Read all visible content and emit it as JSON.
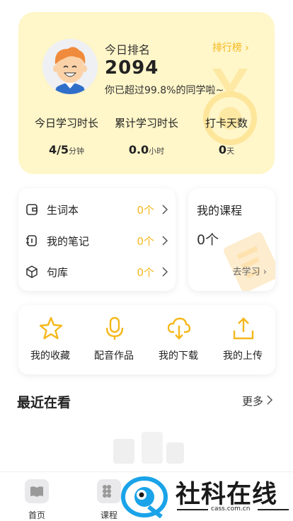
{
  "rank": {
    "label": "今日排名",
    "link": "排行榜",
    "value": "2094",
    "desc": "你已超过99.8%的同学啦~"
  },
  "stats": [
    {
      "label": "今日学习时长",
      "value": "4/5",
      "unit": "分钟"
    },
    {
      "label": "累计学习时长",
      "value": "0.0",
      "unit": "小时"
    },
    {
      "label": "打卡天数",
      "value": "0",
      "unit": "天"
    }
  ],
  "lists": [
    {
      "label": "生词本",
      "count": "0个",
      "icon": "wallet-icon"
    },
    {
      "label": "我的笔记",
      "count": "0个",
      "icon": "notebook-icon"
    },
    {
      "label": "句库",
      "count": "0个",
      "icon": "box-icon"
    }
  ],
  "course": {
    "title": "我的课程",
    "count": "0个",
    "go": "去学习"
  },
  "actions": [
    {
      "label": "我的收藏",
      "icon": "star-icon"
    },
    {
      "label": "配音作品",
      "icon": "microphone-icon"
    },
    {
      "label": "我的下载",
      "icon": "cloud-download-icon"
    },
    {
      "label": "我的上传",
      "icon": "upload-icon"
    }
  ],
  "recent": {
    "title": "最近在看",
    "more": "更多"
  },
  "tabs": [
    {
      "label": "首页",
      "icon": "book-icon"
    },
    {
      "label": "课程",
      "icon": "grid-icon"
    }
  ],
  "watermark": {
    "text": "社科在线",
    "url": "cass.com.cn"
  },
  "colors": {
    "accent": "#f5b81c",
    "card_bg": "#fff6c9"
  }
}
